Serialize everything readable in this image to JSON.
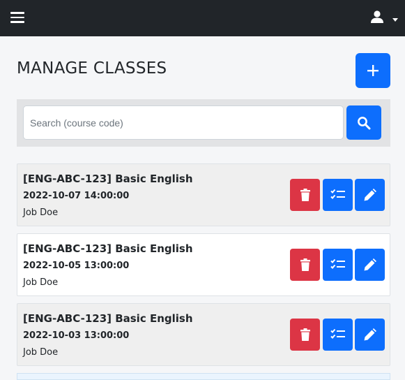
{
  "navbar": {
    "menu_icon": "hamburger-icon",
    "user_icon": "user-icon"
  },
  "page": {
    "title": "MANAGE CLASSES"
  },
  "search": {
    "placeholder": "Search (course code)",
    "value": ""
  },
  "classes": [
    {
      "name": "[ENG-ABC-123] Basic English",
      "datetime": "2022-10-07 14:00:00",
      "teacher": "Job Doe"
    },
    {
      "name": "[ENG-ABC-123] Basic English",
      "datetime": "2022-10-05 13:00:00",
      "teacher": "Job Doe"
    },
    {
      "name": "[ENG-ABC-123] Basic English",
      "datetime": "2022-10-03 13:00:00",
      "teacher": "Job Doe"
    }
  ],
  "colors": {
    "navbar": "#212529",
    "primary": "#0d6efd",
    "danger": "#dc3545",
    "odd_card": "#efefef",
    "even_card": "#ffffff"
  }
}
